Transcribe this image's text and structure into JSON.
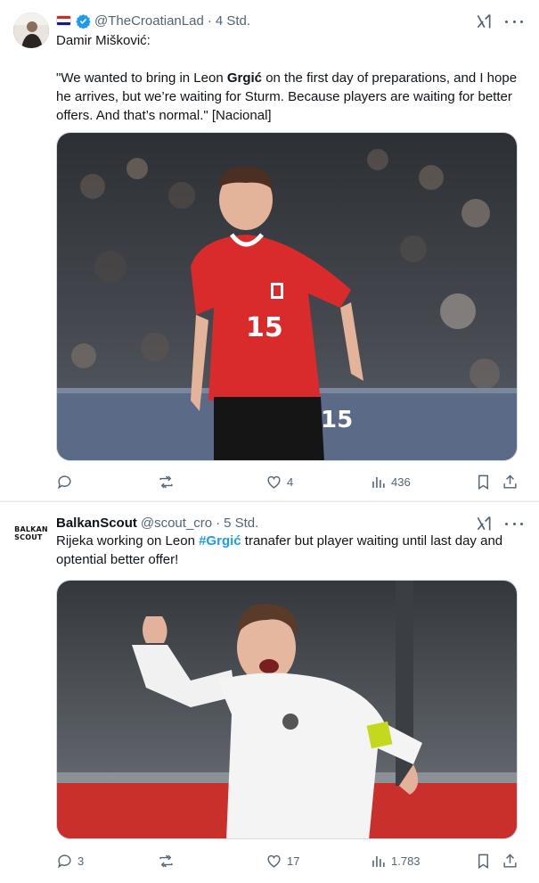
{
  "tweets": [
    {
      "handle": "@TheCroatianLad",
      "time": "4 Std.",
      "line1": "Damir Mišković:",
      "quote_pre": "\"We wanted to bring in Leon ",
      "quote_bold": "Grgić",
      "quote_post": " on the first day of preparations, and I hope he arrives, but we’re waiting for Sturm. Because players are waiting for better offers. And that’s normal.\" [Nacional]",
      "replies": "",
      "reposts": "",
      "likes": "4",
      "views": "436",
      "icons": {
        "verified": "verified-badge-icon",
        "flag": "croatian-flag-icon"
      }
    },
    {
      "display_name": "BalkanScout",
      "handle": "@scout_cro",
      "time": "5 Std.",
      "text_pre": "Rijeka working on Leon ",
      "hashtag": "#Grgić",
      "text_post": " tranafer but player waiting until last day and optential better offer!",
      "avatar_logo_line1": "BALKAN",
      "avatar_logo_line2": "SCOUT",
      "replies": "3",
      "reposts": "",
      "likes": "17",
      "views": "1.783"
    }
  ],
  "colors": {
    "link": "#1d9bf0",
    "muted": "#536471",
    "text": "#0f1419"
  }
}
